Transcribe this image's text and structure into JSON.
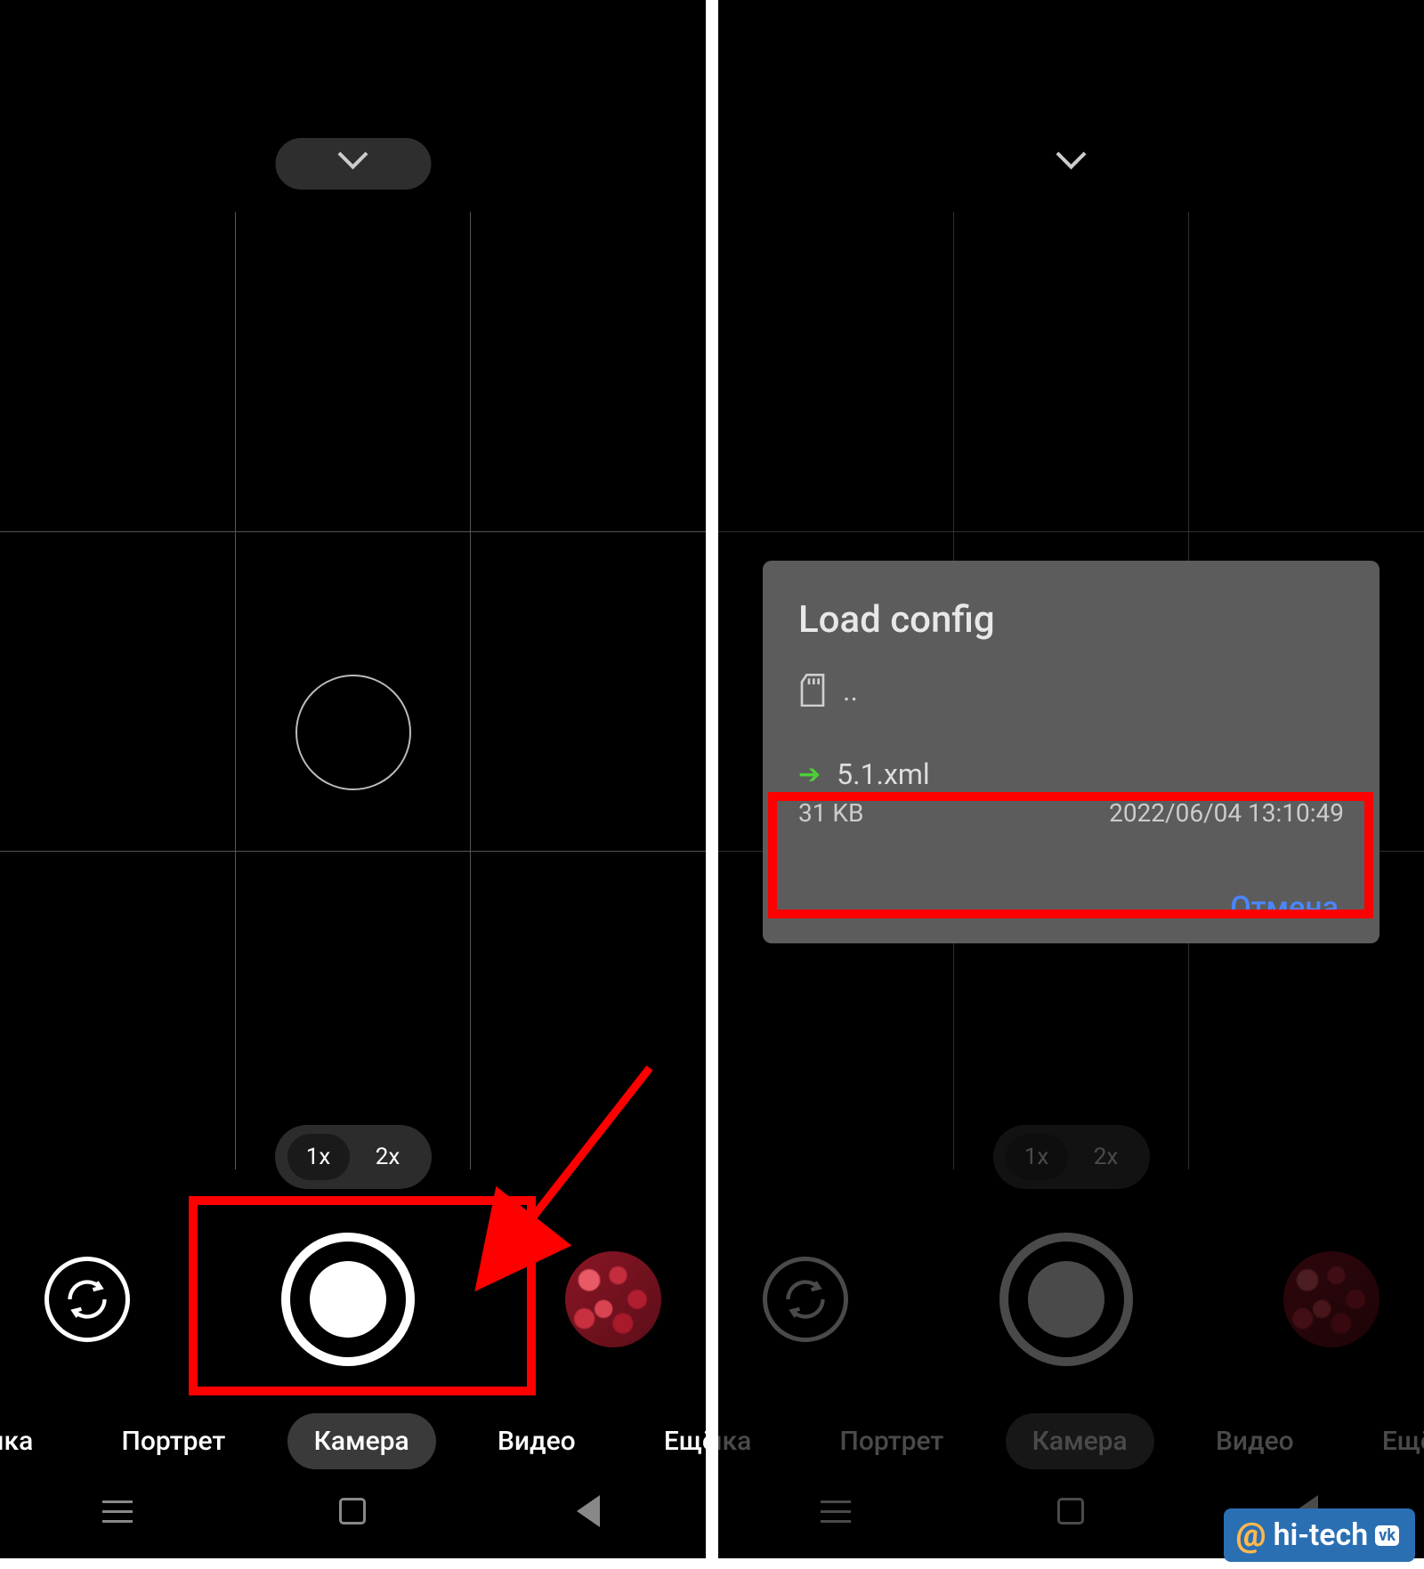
{
  "left": {
    "zoom": {
      "options": [
        "1x",
        "2x"
      ],
      "active": "1x"
    },
    "modes": {
      "items": [
        "мка",
        "Портрет",
        "Камера",
        "Видео",
        "Ещё"
      ],
      "active": "Камера"
    }
  },
  "right": {
    "zoom": {
      "options": [
        "1x",
        "2x"
      ],
      "active": "1x"
    },
    "modes": {
      "items": [
        "мка",
        "Портрет",
        "Камера",
        "Видео",
        "Ещё"
      ],
      "active": "Камера"
    },
    "dialog": {
      "title": "Load config",
      "up_label": "..",
      "file": {
        "name": "5.1.xml",
        "size": "31 KB",
        "date": "2022/06/04 13:10:49"
      },
      "cancel": "Отмена"
    }
  },
  "watermark": {
    "at": "@",
    "brand": "hi-tech",
    "vk": "vk"
  }
}
